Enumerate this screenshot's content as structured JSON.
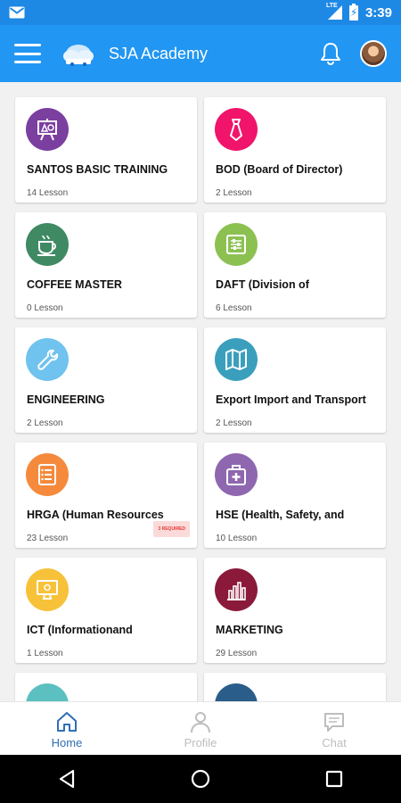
{
  "status_bar": {
    "time": "3:39",
    "network": "LTE"
  },
  "app_bar": {
    "title": "SJA Academy"
  },
  "courses": [
    {
      "title": "SANTOS BASIC TRAINING",
      "lessons": "14 Lesson",
      "color": "#7b3fa0",
      "icon": "presentation-icon"
    },
    {
      "title": "BOD (Board of Director)",
      "lessons": "2 Lesson",
      "color": "#f0146b",
      "icon": "necktie-icon"
    },
    {
      "title": "COFFEE MASTER",
      "lessons": "0 Lesson",
      "color": "#3f8a63",
      "icon": "coffee-cup-icon"
    },
    {
      "title": "DAFT (Division of",
      "lessons": "6 Lesson",
      "color": "#8cc152",
      "icon": "settings-sliders-icon"
    },
    {
      "title": "ENGINEERING",
      "lessons": "2 Lesson",
      "color": "#6fc3ee",
      "icon": "wrench-icon"
    },
    {
      "title": "Export Import and Transport",
      "lessons": "2 Lesson",
      "color": "#3a9fbd",
      "icon": "map-icon"
    },
    {
      "title": "HRGA (Human Resources",
      "lessons": "23 Lesson",
      "color": "#f58a3c",
      "icon": "list-document-icon",
      "badge": "3 REQUIRED"
    },
    {
      "title": "HSE (Health, Safety, and",
      "lessons": "10 Lesson",
      "color": "#8e67b0",
      "icon": "first-aid-kit-icon"
    },
    {
      "title": "ICT (Informationand",
      "lessons": "1 Lesson",
      "color": "#f7c23a",
      "icon": "computer-monitor-icon"
    },
    {
      "title": "MARKETING",
      "lessons": "29 Lesson",
      "color": "#8b1a3a",
      "icon": "bar-chart-icon"
    },
    {
      "title": "",
      "lessons": "",
      "color": "#5cc0c0",
      "icon": ""
    },
    {
      "title": "",
      "lessons": "",
      "color": "#2a5d8a",
      "icon": ""
    }
  ],
  "bottom_nav": {
    "home": "Home",
    "profile": "Profile",
    "chat": "Chat"
  },
  "colors": {
    "status_bar": "#1e88e5",
    "app_bar": "#2196f3",
    "nav_active": "#2f6fb5",
    "nav_inactive": "#bdbdbd"
  }
}
